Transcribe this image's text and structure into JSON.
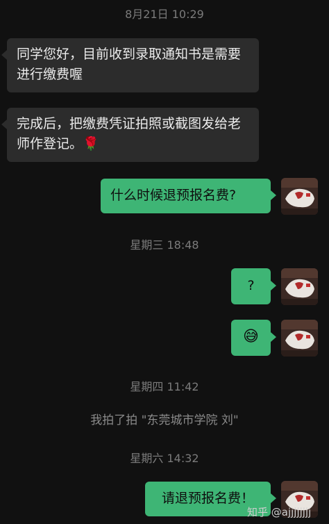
{
  "messages": {
    "time1": "8月21日 10:29",
    "in1": "同学您好，目前收到录取通知书是需要进行缴费喔",
    "in2": "完成后，把缴费凭证拍照或截图发给老师作登记。",
    "in2_emoji": "🌹",
    "out1": "什么时候退预报名费?",
    "time2": "星期三 18:48",
    "out2": "?",
    "out3_emoji": "😅",
    "time3": "星期四 11:42",
    "pat_text": "我拍了拍 \"东莞城市学院 刘\"",
    "time4": "星期六 14:32",
    "out4": "请退预报名费！"
  },
  "watermark": "知乎 @ajjjjjjjj",
  "colors": {
    "background": "#111111",
    "incoming_bubble": "#2c2c2c",
    "outgoing_bubble": "#3eb575"
  }
}
